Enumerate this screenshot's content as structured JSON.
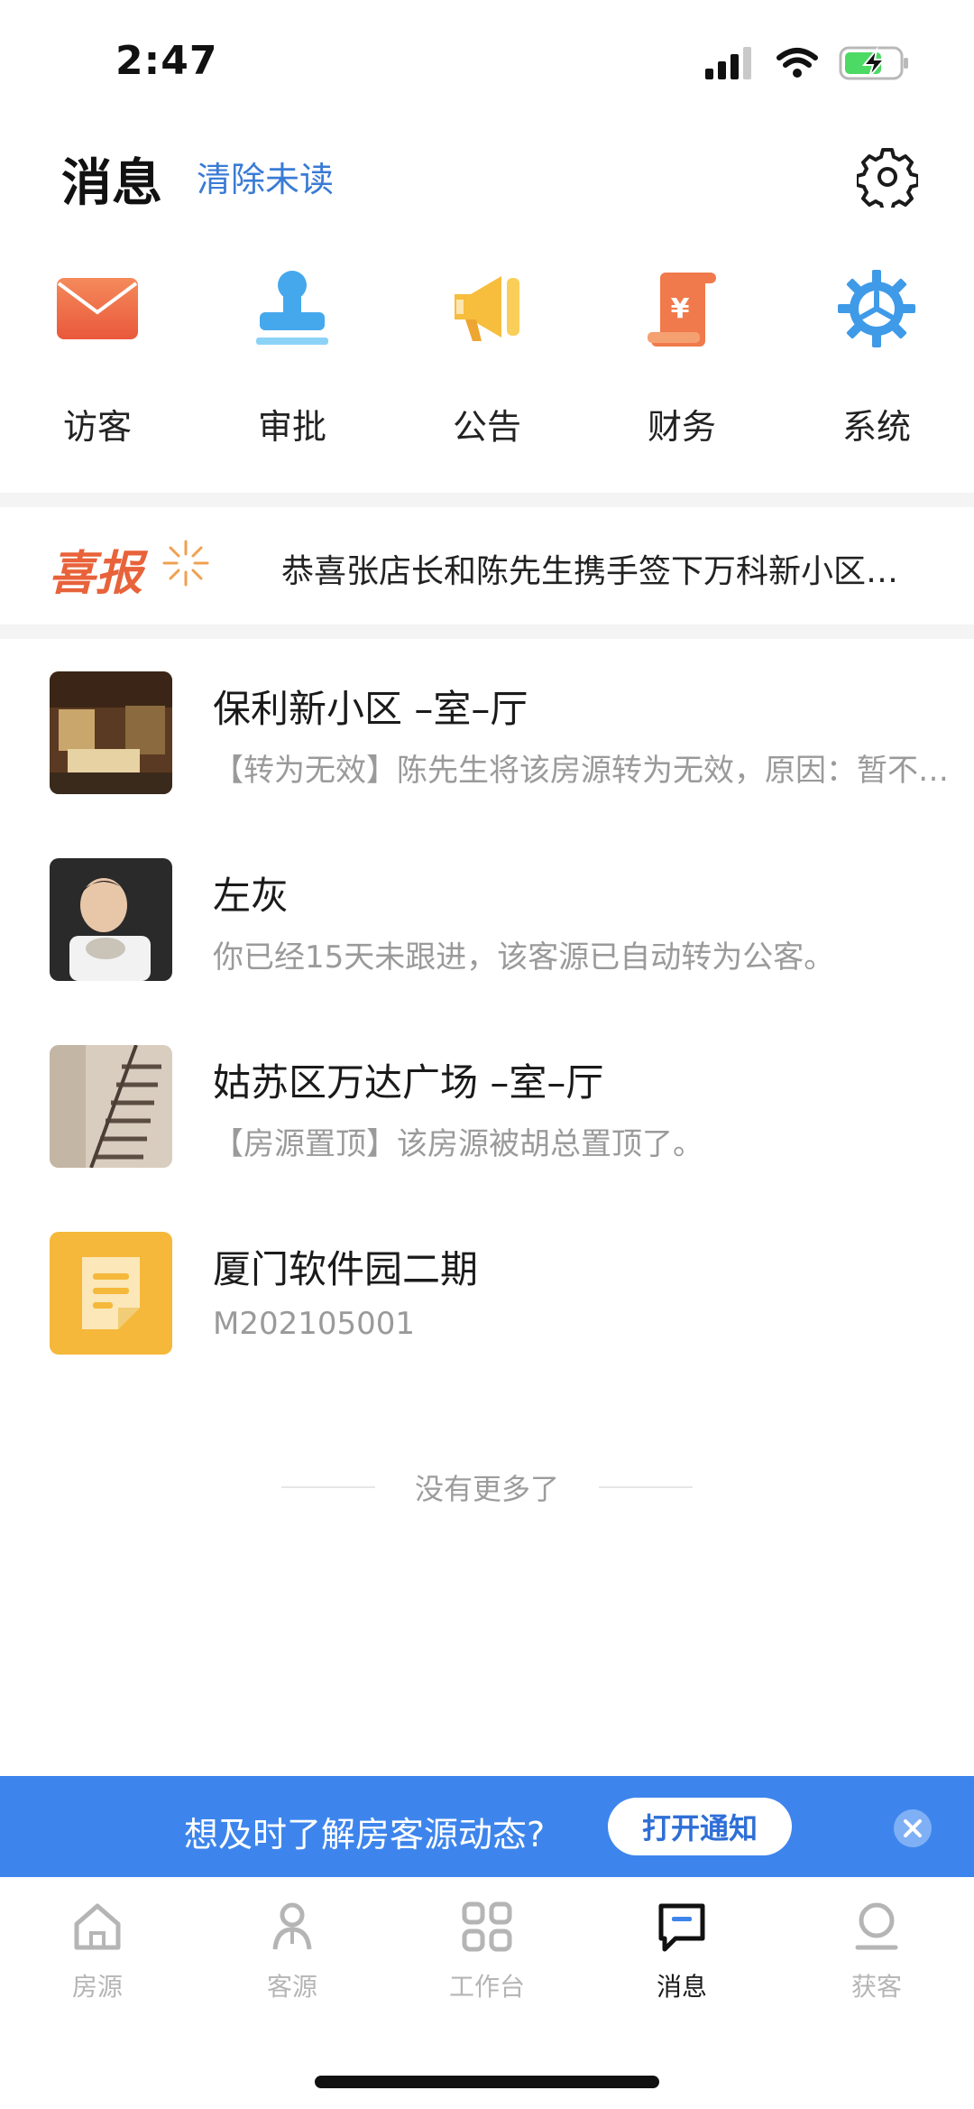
{
  "status_bar": {
    "time": "2:47"
  },
  "header": {
    "title": "消息",
    "clear_unread": "清除未读"
  },
  "categories": [
    {
      "label": "访客",
      "icon": "envelope-icon"
    },
    {
      "label": "审批",
      "icon": "stamp-icon"
    },
    {
      "label": "公告",
      "icon": "megaphone-icon"
    },
    {
      "label": "财务",
      "icon": "finance-scroll-icon"
    },
    {
      "label": "系统",
      "icon": "gear-icon"
    }
  ],
  "banner": {
    "logo_text": "喜报",
    "text": "恭喜张店长和陈先生携手签下万科新小区一套三室两厅"
  },
  "messages": [
    {
      "title": "保利新小区 –室–厅",
      "subtitle": "【转为无效】陈先生将该房源转为无效，原因：暂不出售",
      "thumb": "room-interior-photo"
    },
    {
      "title": "左灰",
      "subtitle": "你已经15天未跟进，该客源已自动转为公客。",
      "thumb": "person-avatar-photo"
    },
    {
      "title": "姑苏区万达广场 –室–厅",
      "subtitle": "【房源置顶】该房源被胡总置顶了。",
      "thumb": "staircase-photo"
    },
    {
      "title": "厦门软件园二期",
      "subtitle": "M202105001",
      "thumb": "document-icon"
    }
  ],
  "no_more": "没有更多了",
  "notification": {
    "text": "想及时了解房客源动态?",
    "button": "打开通知"
  },
  "tabbar": [
    {
      "label": "房源",
      "icon": "house-icon",
      "active": false
    },
    {
      "label": "客源",
      "icon": "person-icon",
      "active": false
    },
    {
      "label": "工作台",
      "icon": "grid-icon",
      "active": false
    },
    {
      "label": "消息",
      "icon": "chat-bubble-icon",
      "active": true
    },
    {
      "label": "获客",
      "icon": "acquire-icon",
      "active": false
    }
  ],
  "colors": {
    "accent_blue": "#3d85ec",
    "link_blue": "#3a7bd5",
    "banner_orange": "#e8623a",
    "doc_yellow": "#f5b83a"
  }
}
